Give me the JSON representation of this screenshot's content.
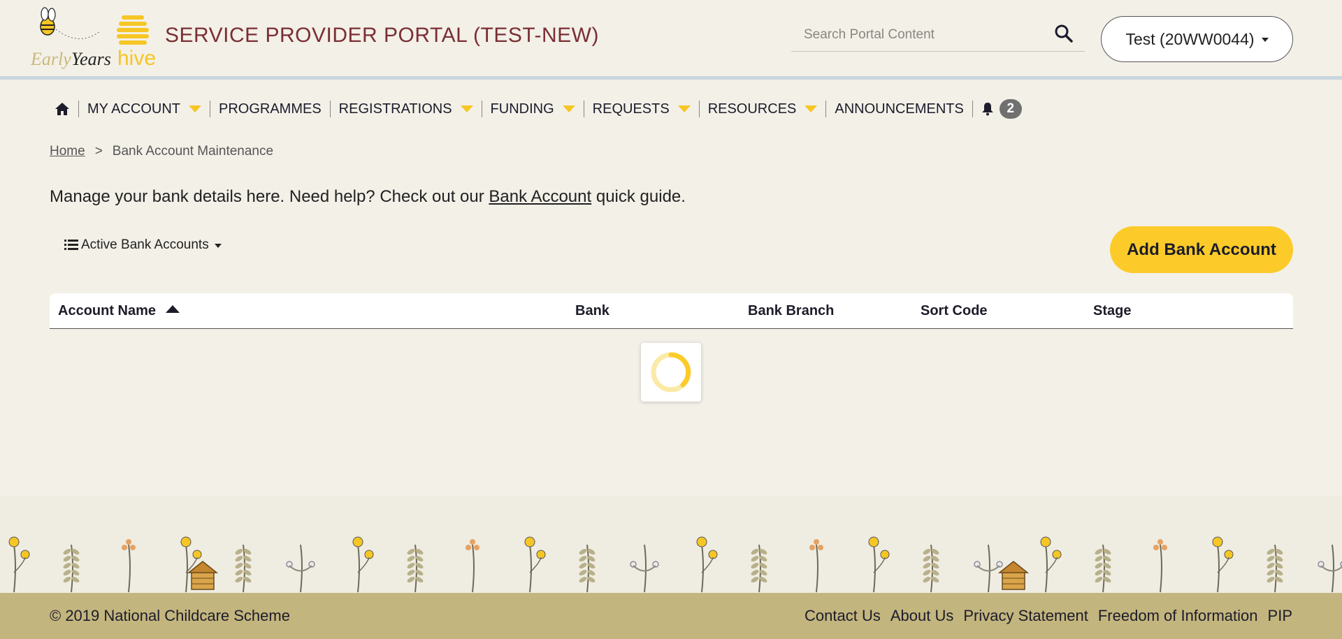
{
  "header": {
    "logo_text_1": "Early",
    "logo_text_2": "Years",
    "logo_text_3": "hive",
    "portal_title": "SERVICE PROVIDER PORTAL (TEST-NEW)",
    "search_placeholder": "Search Portal Content",
    "search_icon": "search-icon",
    "user_label": "Test (20WW0044)"
  },
  "nav": {
    "home_icon": "home-icon",
    "items": [
      {
        "label": "MY ACCOUNT",
        "dropdown": true
      },
      {
        "label": "PROGRAMMES",
        "dropdown": false
      },
      {
        "label": "REGISTRATIONS",
        "dropdown": true
      },
      {
        "label": "FUNDING",
        "dropdown": true
      },
      {
        "label": "REQUESTS",
        "dropdown": true
      },
      {
        "label": "RESOURCES",
        "dropdown": true
      },
      {
        "label": "ANNOUNCEMENTS",
        "dropdown": false
      }
    ],
    "notification_icon": "bell-icon",
    "notification_count": "2"
  },
  "breadcrumb": {
    "home": "Home",
    "separator": ">",
    "current": "Bank Account Maintenance"
  },
  "intro": {
    "before": "Manage your bank details here. Need help? Check out our ",
    "link": "Bank Account",
    "after": " quick guide."
  },
  "view_select": {
    "icon": "list-icon",
    "label": "Active Bank Accounts"
  },
  "add_button": "Add Bank Account",
  "table": {
    "columns": [
      "Account Name",
      "Bank",
      "Bank Branch",
      "Sort Code",
      "Stage"
    ],
    "sort_column": "Account Name",
    "sort_direction": "ascending",
    "rows": []
  },
  "loading": true,
  "footer": {
    "copyright": "© 2019 National Childcare Scheme",
    "links": [
      "Contact Us",
      "About Us",
      "Privacy Statement",
      "Freedom of Information",
      "PIP"
    ]
  },
  "colors": {
    "accent_yellow": "#fccb29",
    "title_maroon": "#7a2e33",
    "footer_bg": "#c3b57e",
    "page_bg": "#f3f0e8"
  }
}
